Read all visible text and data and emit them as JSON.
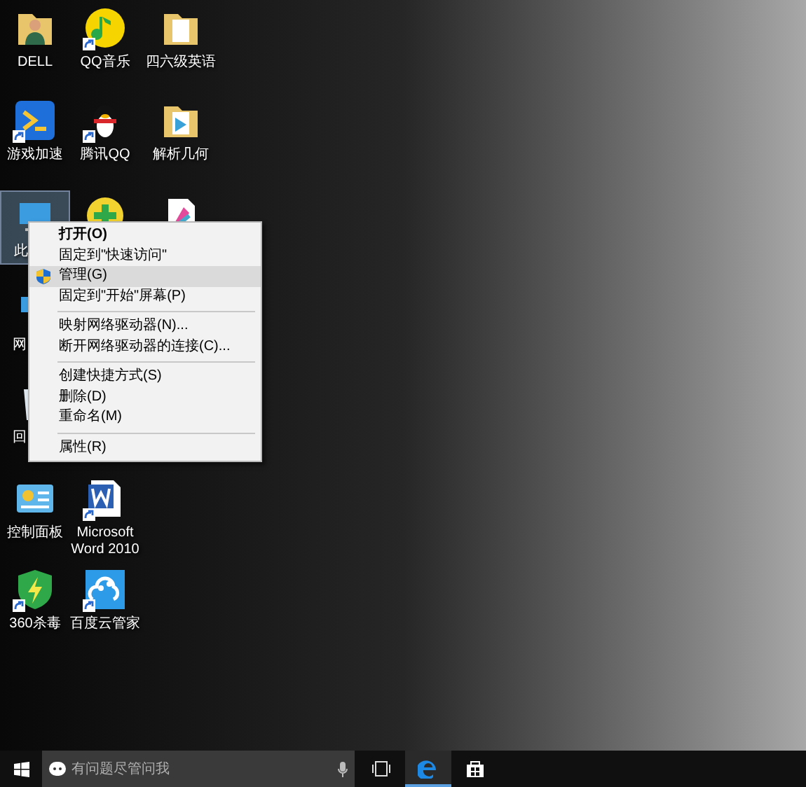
{
  "desktop_icons": [
    {
      "label": "DELL",
      "kind": "folder-person",
      "shortcut": false,
      "selected": false
    },
    {
      "label": "QQ音乐",
      "kind": "music",
      "shortcut": true,
      "selected": false
    },
    {
      "label": "四六级英语",
      "kind": "folder",
      "shortcut": false,
      "selected": false
    },
    {
      "label": "游戏加速",
      "kind": "game",
      "shortcut": true,
      "selected": false
    },
    {
      "label": "腾讯QQ",
      "kind": "penguin",
      "shortcut": true,
      "selected": false
    },
    {
      "label": "解析几何",
      "kind": "folder-doc",
      "shortcut": false,
      "selected": false
    },
    {
      "label": "此",
      "kind": "computer",
      "shortcut": false,
      "selected": true
    },
    {
      "kind": "plus",
      "selected": false
    },
    {
      "kind": "file-color",
      "selected": false
    },
    {
      "label": "网",
      "kind": "network",
      "shortcut": false,
      "selected": false
    },
    {
      "label": "回",
      "kind": "recycle",
      "shortcut": false,
      "selected": false
    },
    {
      "label": "控制面板",
      "kind": "control-panel",
      "shortcut": false,
      "selected": false
    },
    {
      "label": "Microsoft Word 2010",
      "kind": "word",
      "shortcut": true,
      "selected": false
    },
    {
      "label": "360杀毒",
      "kind": "shield",
      "shortcut": true,
      "selected": false
    },
    {
      "label": "百度云管家",
      "kind": "cloud",
      "shortcut": true,
      "selected": false
    }
  ],
  "context_menu": [
    {
      "kind": "item",
      "label": "打开(O)",
      "default": true,
      "selected": false
    },
    {
      "kind": "item",
      "label": "固定到\"快速访问\"",
      "default": false,
      "selected": false
    },
    {
      "kind": "admin-item",
      "label": "管理(G)",
      "default": false,
      "selected": true
    },
    {
      "kind": "item",
      "label": "固定到\"开始\"屏幕(P)",
      "default": false,
      "selected": false
    },
    {
      "kind": "separator"
    },
    {
      "kind": "item",
      "label": "映射网络驱动器(N)...",
      "default": false,
      "selected": false
    },
    {
      "kind": "item",
      "label": "断开网络驱动器的连接(C)...",
      "default": false,
      "selected": false
    },
    {
      "kind": "separator"
    },
    {
      "kind": "item",
      "label": "创建快捷方式(S)",
      "default": false,
      "selected": false
    },
    {
      "kind": "item",
      "label": "删除(D)",
      "default": false,
      "selected": false
    },
    {
      "kind": "item",
      "label": "重命名(M)",
      "default": false,
      "selected": false
    },
    {
      "kind": "separator"
    },
    {
      "kind": "item",
      "label": "属性(R)",
      "default": false,
      "selected": false
    }
  ],
  "taskbar": {
    "search": {
      "placeholder": "有问题尽管问我"
    },
    "apps": [
      {
        "kind": "task-view",
        "active": false
      },
      {
        "kind": "edge",
        "active": true
      },
      {
        "kind": "store",
        "active": false
      }
    ]
  }
}
